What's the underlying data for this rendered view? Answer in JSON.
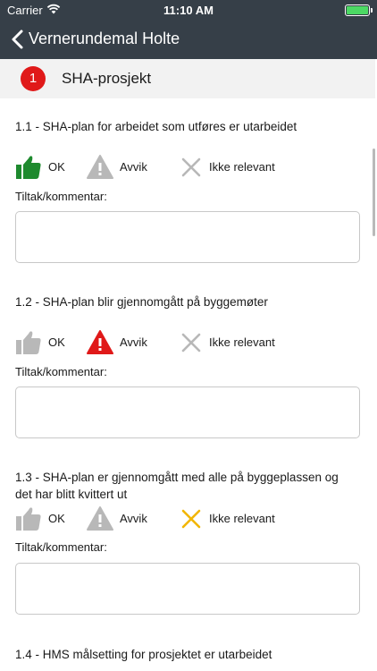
{
  "status": {
    "carrier": "Carrier",
    "time": "11:10 AM"
  },
  "nav": {
    "title": "Vernerundemal Holte"
  },
  "section": {
    "number": "1",
    "title": "SHA-prosjekt"
  },
  "options": {
    "ok": "OK",
    "avvik": "Avvik",
    "ikke": "Ikke relevant"
  },
  "comment_label": "Tiltak/kommentar:",
  "items": [
    {
      "question": "1.1 - SHA-plan for arbeidet som utføres er utarbeidet",
      "selected": "ok"
    },
    {
      "question": "1.2 - SHA-plan blir gjennomgått på byggemøter",
      "selected": "avvik"
    },
    {
      "question": "1.3 - SHA-plan er gjennomgått med alle på byggeplassen og det har blitt kvittert ut",
      "selected": "ikke"
    },
    {
      "question": "1.4 - HMS målsetting for prosjektet er utarbeidet"
    }
  ],
  "colors": {
    "nav_bg": "#363f48",
    "ok_active": "#1e8a2e",
    "avvik_active": "#e01919",
    "ikke_active": "#f2b600",
    "inactive": "#b8b8b8"
  }
}
